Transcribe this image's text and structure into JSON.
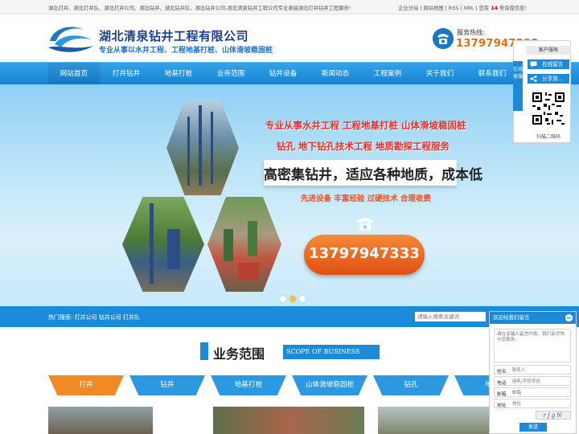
{
  "topbar": {
    "intro": "湖北打井、湖北打井队、湖北打井公司、湖北钻井、湖北钻井队、湖北钻井公司-湖北清泉钻井工程公司专业承接湖北打井钻井工程服务!",
    "links": [
      "企业分站",
      "|",
      "网站地图",
      "|",
      "RSS",
      "|",
      "XML",
      "|",
      "您有",
      "14",
      "条询盘信息!"
    ]
  },
  "header": {
    "company_name": "湖北清泉钻井工程有限公司",
    "tagline": "专业从事以水井工程、工程地基打桩、山体滑坡稳固桩",
    "hotline_label": "服务热线:",
    "hotline_number": "13797947333"
  },
  "nav": [
    "网站首页",
    "打井钻井",
    "地基打桩",
    "业务范围",
    "钻井设备",
    "新闻动态",
    "工程案例",
    "关于我们",
    "联系我们"
  ],
  "banner": {
    "line1": "专业从事水井工程  工程地基打桩  山体滑坡稳固桩",
    "line2": "钻孔  地下钻孔技术工程  地质勘探工程服务",
    "line3": "高密集钻井，适应各种地质，成本低",
    "line4": "先进设备  丰富经验  过硬技术  合理收费",
    "phone": "13797947333"
  },
  "searchbar": {
    "hot_label": "热门搜索:  打井公司  钻井公司  打井队",
    "placeholder": "请输入搜索关键词"
  },
  "section": {
    "title": "业务范围",
    "subtitle": "SCOPE OF BUSINESS"
  },
  "tabs": [
    "打井",
    "钻井",
    "地基打桩",
    "山体滑坡稳固桩",
    "钻孔",
    "地质"
  ],
  "float": {
    "head": "客户服务",
    "vertical": "在线客服",
    "btn1": "在线留言",
    "btn2": "分享到...",
    "qr_label": "扫描二维码"
  },
  "message": {
    "header": "欢迎给我们留言",
    "content_placeholder": "请在此输入留言内容，我们会尽快与您联系。",
    "name_label": "姓名",
    "name_placeholder": "联系人",
    "phone_label": "电话",
    "phone_placeholder": "座机/手机号码",
    "email_label": "邮箱",
    "email_placeholder": "邮箱",
    "addr_label": "地址",
    "addr_placeholder": "地址",
    "captcha": "rJgN",
    "send": "发送"
  },
  "colors": {
    "brand_blue": "#1c8ad7",
    "accent_orange": "#f08a24",
    "hotline_orange": "#ec6a0c",
    "slogan_red": "#e12f2f"
  }
}
